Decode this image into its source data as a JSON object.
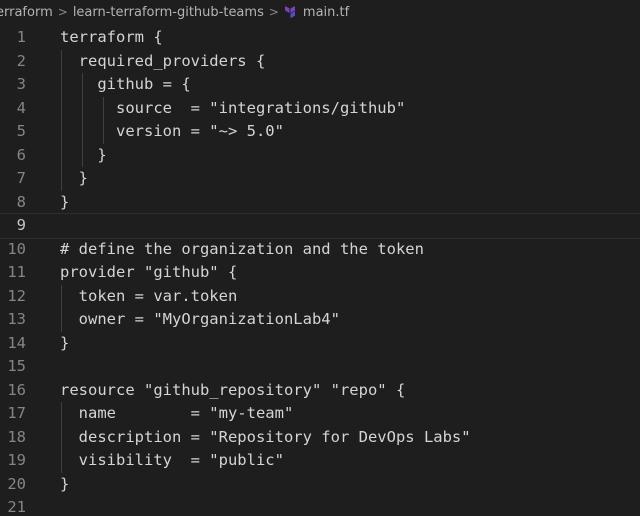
{
  "breadcrumb": {
    "items": [
      "erraform",
      "learn-terraform-github-teams",
      "main.tf"
    ],
    "separator": ">",
    "file_icon": "terraform-icon"
  },
  "editor": {
    "current_line": 9,
    "lines": [
      {
        "number": "1",
        "text": "terraform {",
        "indent": 0
      },
      {
        "number": "2",
        "text": "  required_providers {",
        "indent": 1
      },
      {
        "number": "3",
        "text": "    github = {",
        "indent": 2
      },
      {
        "number": "4",
        "text": "      source  = \"integrations/github\"",
        "indent": 3
      },
      {
        "number": "5",
        "text": "      version = \"~> 5.0\"",
        "indent": 3
      },
      {
        "number": "6",
        "text": "    }",
        "indent": 2
      },
      {
        "number": "7",
        "text": "  }",
        "indent": 1
      },
      {
        "number": "8",
        "text": "}",
        "indent": 0
      },
      {
        "number": "9",
        "text": "",
        "indent": 0
      },
      {
        "number": "10",
        "text": "# define the organization and the token",
        "indent": 0
      },
      {
        "number": "11",
        "text": "provider \"github\" {",
        "indent": 0
      },
      {
        "number": "12",
        "text": "  token = var.token",
        "indent": 1
      },
      {
        "number": "13",
        "text": "  owner = \"MyOrganizationLab4\"",
        "indent": 1
      },
      {
        "number": "14",
        "text": "}",
        "indent": 0
      },
      {
        "number": "15",
        "text": "",
        "indent": 0
      },
      {
        "number": "16",
        "text": "resource \"github_repository\" \"repo\" {",
        "indent": 0
      },
      {
        "number": "17",
        "text": "  name        = \"my-team\"",
        "indent": 1
      },
      {
        "number": "18",
        "text": "  description = \"Repository for DevOps Labs\"",
        "indent": 1
      },
      {
        "number": "19",
        "text": "  visibility  = \"public\"",
        "indent": 1
      },
      {
        "number": "20",
        "text": "}",
        "indent": 0
      },
      {
        "number": "21",
        "text": "",
        "indent": 0
      }
    ]
  },
  "colors": {
    "background": "#1e1e1e",
    "text": "#d4d4d4",
    "line_number": "#858585",
    "active_line_number": "#c6c6c6",
    "indent_guide": "#404040",
    "terraform_icon": "#7b42bc"
  }
}
